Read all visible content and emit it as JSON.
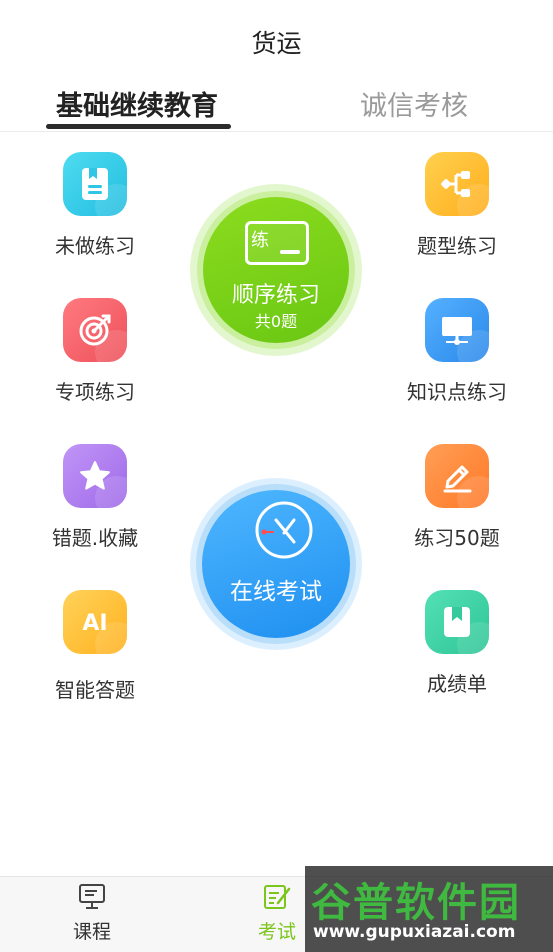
{
  "header": {
    "title": "货运"
  },
  "tabs": [
    {
      "label": "基础继续教育",
      "active": true
    },
    {
      "label": "诚信考核",
      "active": false
    }
  ],
  "grid": {
    "left": [
      {
        "label": "未做练习",
        "icon": "document-icon",
        "color": "#3ccde8"
      },
      {
        "label": "专项练习",
        "icon": "target-icon",
        "color": "#f2626b"
      },
      {
        "label": "错题.收藏",
        "icon": "star-icon",
        "color": "#b27ef0"
      },
      {
        "label": "智能答题",
        "icon": "ai-icon",
        "color": "#ffc536"
      }
    ],
    "right": [
      {
        "label": "题型练习",
        "icon": "branch-icon",
        "color": "#ffc233"
      },
      {
        "label": "知识点练习",
        "icon": "presentation-icon",
        "color": "#3f9cf1"
      },
      {
        "label": "练习50题",
        "icon": "pen-icon",
        "color": "#ff8a3b"
      },
      {
        "label": "成绩单",
        "icon": "bookmark-icon",
        "color": "#3fd2a4"
      }
    ]
  },
  "practice": {
    "card_char": "练",
    "label": "顺序练习",
    "count_label": "共0题"
  },
  "exam": {
    "label": "在线考试"
  },
  "bottom_nav": [
    {
      "label": "课程",
      "icon": "monitor-icon",
      "active": false
    },
    {
      "label": "考试",
      "icon": "edit-icon",
      "active": true
    }
  ],
  "watermark": {
    "main": "谷普软件园",
    "url": "www.gupuxiazai.com"
  }
}
